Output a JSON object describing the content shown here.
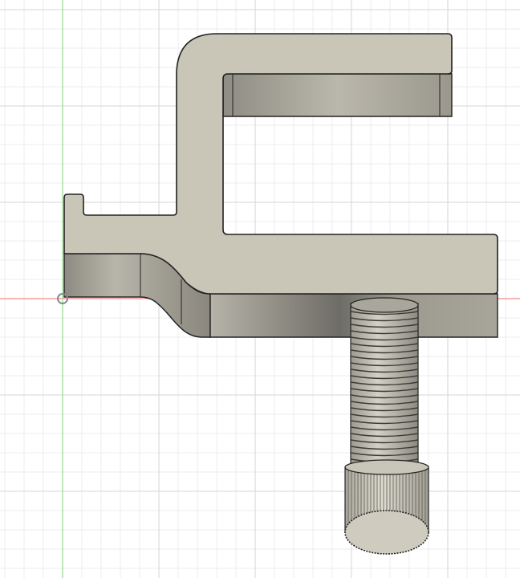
{
  "viewport": {
    "background": "#ffffff",
    "grid_minor_color": "#ececec",
    "grid_major_color": "#d6d6d6",
    "x_axis_color": "#f08a8a",
    "y_axis_color": "#8fdc8f"
  },
  "model": {
    "body_face_color": "#c9c6b8",
    "body_side_color": "#aeaba0",
    "body_shadow_color": "#6f6d66",
    "outline_color": "#222222",
    "screw_color": "#b9b6aa",
    "thread_line_color": "#3c3a36",
    "knob_color": "#cfccbf"
  },
  "icons": {
    "origin_marker": "origin-circle-icon"
  }
}
